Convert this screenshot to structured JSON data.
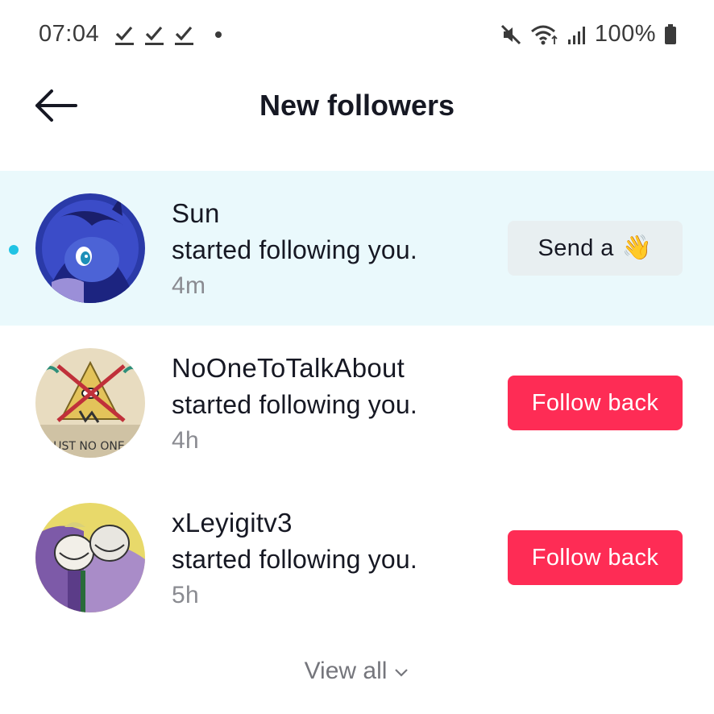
{
  "status_bar": {
    "time": "07:04",
    "battery": "100%",
    "icons": [
      "check-mark-icon",
      "check-mark-icon",
      "check-mark-icon",
      "dot-icon",
      "mute-icon",
      "wifi-icon",
      "signal-icon",
      "battery-icon"
    ]
  },
  "header": {
    "title": "New followers",
    "back_icon": "arrow-left-icon"
  },
  "followers": [
    {
      "name": "Sun",
      "action": "started following you.",
      "time": "4m",
      "unread": true,
      "button_label": "Send a",
      "button_emoji": "👋",
      "button_style": "wave"
    },
    {
      "name": "NoOneToTalkAbout",
      "action": "started following you.",
      "time": "4h",
      "unread": false,
      "button_label": "Follow back",
      "button_style": "follow"
    },
    {
      "name": "xLeyigitv3",
      "action": "started following you.",
      "time": "5h",
      "unread": false,
      "button_label": "Follow back",
      "button_style": "follow"
    }
  ],
  "footer": {
    "view_all": "View all",
    "chevron_icon": "chevron-down-icon"
  },
  "colors": {
    "accent": "#fe2c55",
    "unread_bg": "#eaf9fc",
    "unread_dot": "#20c3e4",
    "wave_button_bg": "#e8eff1"
  }
}
